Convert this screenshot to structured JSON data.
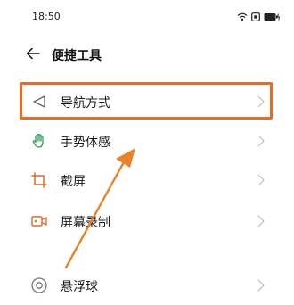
{
  "status_bar": {
    "time": "18:50",
    "icons": [
      "wifi-icon",
      "nfc-icon",
      "battery-icon"
    ]
  },
  "header": {
    "back_icon": "arrow-left-icon",
    "title": "便捷工具"
  },
  "items": [
    {
      "label": "导航方式",
      "icon": "navigation-triangle-icon",
      "highlighted": true
    },
    {
      "label": "手势体感",
      "icon": "hand-gesture-icon"
    },
    {
      "label": "截屏",
      "icon": "crop-screenshot-icon"
    },
    {
      "label": "屏幕录制",
      "icon": "screen-record-icon"
    },
    {
      "label": "悬浮球",
      "icon": "floating-ball-icon"
    }
  ],
  "annotation": {
    "highlight_color": "#e86a2a",
    "arrow_color": "#e8832a"
  },
  "colors": {
    "accent_icon": "#e06a2e",
    "green_icon": "#2e9e5e",
    "chevron": "#c4c4c4"
  }
}
